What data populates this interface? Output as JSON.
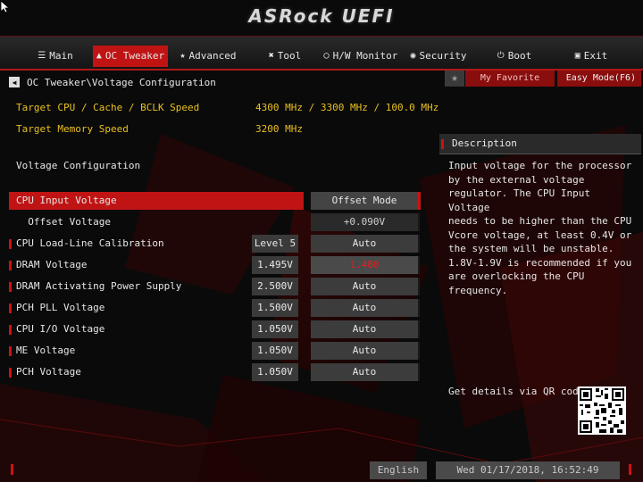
{
  "app": {
    "title": "ASRock UEFI"
  },
  "nav": {
    "tabs": [
      {
        "label": "Main",
        "icon": "list-icon"
      },
      {
        "label": "OC Tweaker",
        "icon": "flame-icon"
      },
      {
        "label": "Advanced",
        "icon": "star-icon"
      },
      {
        "label": "Tool",
        "icon": "tools-icon"
      },
      {
        "label": "H/W Monitor",
        "icon": "monitor-icon"
      },
      {
        "label": "Security",
        "icon": "shield-icon"
      },
      {
        "label": "Boot",
        "icon": "power-icon"
      },
      {
        "label": "Exit",
        "icon": "exit-icon"
      }
    ],
    "active_tab": "OC Tweaker"
  },
  "breadcrumb": "OC Tweaker\\Voltage Configuration",
  "top_buttons": {
    "my_favorite": "My Favorite",
    "easy_mode": "Easy Mode(F6)"
  },
  "info": [
    {
      "label": "Target CPU / Cache / BCLK Speed",
      "value": "4300 MHz / 3300 MHz / 100.0 MHz"
    },
    {
      "label": "Target Memory Speed",
      "value": "3200 MHz"
    }
  ],
  "section_title": "Voltage Configuration",
  "settings": [
    {
      "label": "CPU Input Voltage",
      "value": "",
      "option": "Offset Mode"
    },
    {
      "label": "  Offset Voltage",
      "value": "",
      "option": "+0.090V"
    },
    {
      "label": "CPU Load-Line Calibration",
      "value": "Level 5",
      "option": "Auto"
    },
    {
      "label": "DRAM Voltage",
      "value": "1.495V",
      "option": "1.480"
    },
    {
      "label": "DRAM Activating Power Supply",
      "value": "2.500V",
      "option": "Auto"
    },
    {
      "label": "PCH PLL Voltage",
      "value": "1.500V",
      "option": "Auto"
    },
    {
      "label": "CPU I/O Voltage",
      "value": "1.050V",
      "option": "Auto"
    },
    {
      "label": "ME Voltage",
      "value": "1.050V",
      "option": "Auto"
    },
    {
      "label": "PCH Voltage",
      "value": "1.050V",
      "option": "Auto"
    }
  ],
  "description": {
    "title": "Description",
    "text": "Input voltage for the processor\nby the external voltage\nregulator. The CPU Input Voltage\nneeds to be higher than the CPU\nVcore voltage, at least 0.4V or\nthe system will be unstable.\n1.8V-1.9V is recommended if you\nare overlocking the CPU frequency."
  },
  "qr": {
    "label": "Get details via QR code"
  },
  "footer": {
    "language": "English",
    "datetime": "Wed 01/17/2018, 16:52:49"
  },
  "colors": {
    "accent": "#c01414",
    "warning_text": "#e8c020",
    "panel": "#3a3a3a"
  }
}
